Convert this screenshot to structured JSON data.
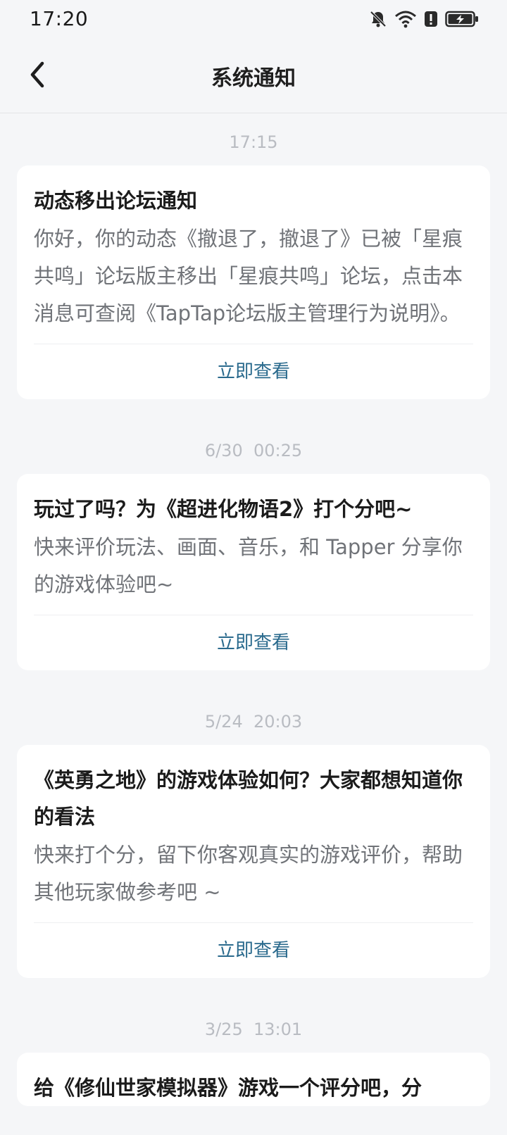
{
  "status_bar": {
    "time": "17:20"
  },
  "header": {
    "title": "系统通知"
  },
  "notifications": [
    {
      "time": "17:15",
      "title": "动态移出论坛通知",
      "body": "你好，你的动态《撤退了，撤退了》已被「星痕共鸣」论坛版主移出「星痕共鸣」论坛，点击本消息可查阅《TapTap论坛版主管理行为说明》。",
      "action": "立即查看"
    },
    {
      "time": "6/30  00:25",
      "title": "玩过了吗？为《超进化物语2》打个分吧~",
      "body": "快来评价玩法、画面、音乐，和 Tapper 分享你的游戏体验吧~",
      "action": "立即查看"
    },
    {
      "time": "5/24  20:03",
      "title": "《英勇之地》的游戏体验如何？大家都想知道你的看法",
      "body": "快来打个分，留下你客观真实的游戏评价，帮助其他玩家做参考吧 ~",
      "action": "立即查看"
    },
    {
      "time": "3/25  13:01",
      "title": "给《修仙世家模拟器》游戏一个评分吧，分"
    }
  ]
}
